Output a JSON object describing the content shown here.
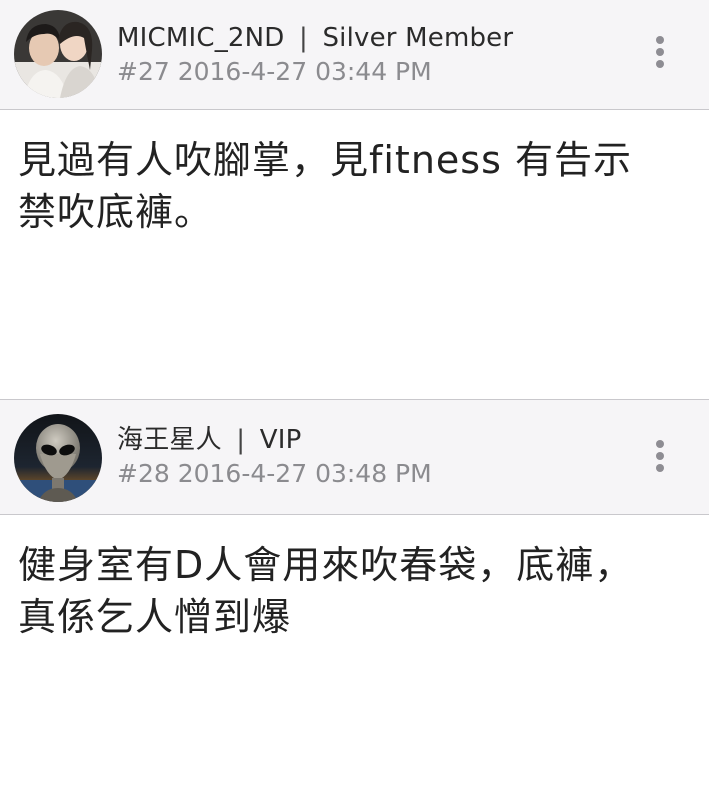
{
  "posts": [
    {
      "username": "MICMIC_2ND",
      "separator": "|",
      "rank": "Silver Member",
      "post_number": "#27",
      "date": "2016-4-27",
      "time": "03:44 PM",
      "body_lines": [
        "見過有人吹腳掌，見fitness 有告示",
        "禁吹底褲。"
      ]
    },
    {
      "username": "海王星人",
      "separator": "|",
      "rank": "VIP",
      "post_number": "#28",
      "date": "2016-4-27",
      "time": "03:48 PM",
      "body_lines": [
        "健身室有D人會用來吹春袋，底褲，",
        "真係乞人憎到爆"
      ]
    }
  ],
  "icons": {
    "more": "more-vertical-icon"
  },
  "colors": {
    "header_bg": "#f6f5f7",
    "body_bg": "#ffffff",
    "timestamp": "#8b8b8f",
    "divider": "#c9c8cc"
  }
}
